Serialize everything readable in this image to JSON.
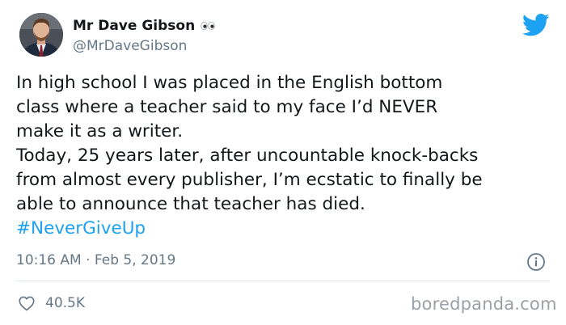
{
  "author": {
    "name": "Mr Dave Gibson",
    "handle": "@MrDaveGibson",
    "name_emoji": "eyes-emoji",
    "avatar_icon": "profile-photo"
  },
  "tweet": {
    "lines": [
      "In high school I was placed in the English bottom",
      "class where a teacher said to my face I’d NEVER",
      "make it as a writer.",
      "Today, 25 years later, after uncountable knock-backs",
      "from almost every publisher, I’m ecstatic to finally be",
      "able to announce that teacher has died."
    ],
    "hashtag": "#NeverGiveUp",
    "timestamp": "10:16 AM · Feb 5, 2019"
  },
  "actions": {
    "likes": "40.5K",
    "like_icon": "heart-icon",
    "info_icon": "info-icon"
  },
  "brand": {
    "logo_icon": "twitter-bird-icon",
    "watermark": "boredpanda.com"
  },
  "colors": {
    "twitter_blue": "#1da1f2",
    "text": "#14171a",
    "muted": "#657786",
    "divider": "#e1e8ed",
    "watermark": "#9aa0a6"
  }
}
